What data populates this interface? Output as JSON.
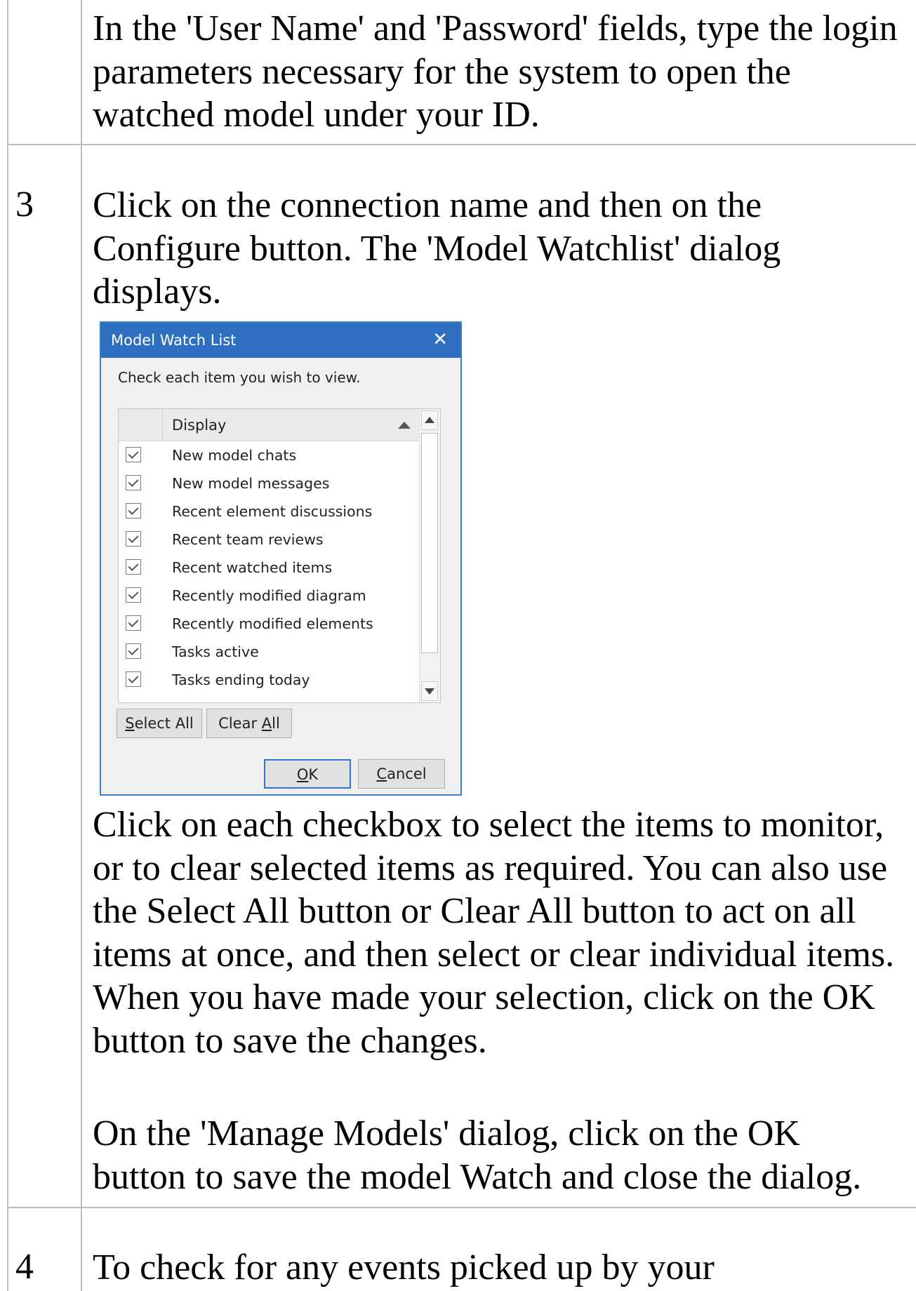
{
  "rows": [
    {
      "number": "",
      "text": "In the 'User Name' and 'Password' fields, type the login parameters necessary for the system to open the watched model under your ID."
    },
    {
      "number": "3",
      "text": "Click on the connection name and then on the Configure button.  The 'Model Watchlist' dialog displays.",
      "after_text_1": "Click on each checkbox to select the items to monitor, or to clear selected items as required. You can also use the Select All button or Clear All button to act on all items at once, and then select or clear individual items. When you have made your selection, click on the OK button to save the changes.",
      "after_text_2": "On the 'Manage Models' dialog, click on the OK button to save the model Watch and close the dialog."
    },
    {
      "number": "4",
      "text": "To check for any events picked up by your"
    }
  ],
  "dialog": {
    "title": "Model Watch List",
    "close_glyph": "✕",
    "prompt": "Check each item you wish to view.",
    "column_header": "Display",
    "items": [
      {
        "label": "New model chats",
        "checked": true
      },
      {
        "label": "New model messages",
        "checked": true
      },
      {
        "label": "Recent element discussions",
        "checked": true
      },
      {
        "label": "Recent team reviews",
        "checked": true
      },
      {
        "label": "Recent watched items",
        "checked": true
      },
      {
        "label": "Recently modified diagram",
        "checked": true
      },
      {
        "label": "Recently modified elements",
        "checked": true
      },
      {
        "label": "Tasks active",
        "checked": true
      },
      {
        "label": "Tasks ending today",
        "checked": true
      }
    ],
    "select_all": {
      "mnemonic": "S",
      "rest": "elect All"
    },
    "clear_all": {
      "before": "Clear ",
      "mnemonic": "A",
      "after": "ll"
    },
    "ok": {
      "mnemonic": "O",
      "rest": "K"
    },
    "cancel": {
      "mnemonic": "C",
      "rest": "ancel"
    },
    "colors": {
      "title_bar": "#2f6fc0",
      "border": "#3a7fc9",
      "default_button_border": "#2f76d0"
    }
  }
}
